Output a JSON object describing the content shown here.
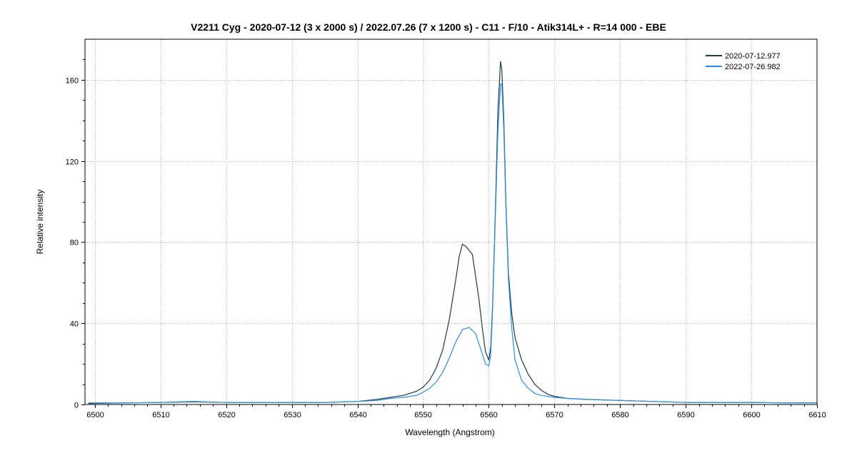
{
  "chart_data": {
    "type": "line",
    "title": "V2211 Cyg -  2020-07-12 (3 x 2000 s) / 2022.07.26 (7 x 1200 s) - C11 - F/10 - Atik314L+  - R=14 000  - EBE",
    "xlabel": "Wavelength (Angstrom)",
    "ylabel": "Relative intensity",
    "xlim": [
      6498.5,
      6610
    ],
    "ylim": [
      0,
      180
    ],
    "xticks": [
      6500,
      6510,
      6520,
      6530,
      6540,
      6550,
      6560,
      6570,
      6580,
      6590,
      6600,
      6610
    ],
    "yticks": [
      0,
      40,
      80,
      120,
      160
    ],
    "grid": true,
    "legend_position": "top-right",
    "series": [
      {
        "name": "2020-07-12.977",
        "color": "#1e3a4a",
        "x": [
          6499,
          6505,
          6510,
          6515,
          6520,
          6525,
          6530,
          6535,
          6540,
          6543,
          6545,
          6547,
          6549,
          6550,
          6551,
          6552,
          6553,
          6554,
          6555,
          6555.5,
          6556,
          6556.5,
          6557,
          6557.5,
          6558,
          6558.5,
          6559,
          6559.5,
          6560,
          6560.3,
          6560.6,
          6561,
          6561.4,
          6561.8,
          6562,
          6562.3,
          6562.6,
          6563,
          6563.5,
          6564,
          6565,
          6566,
          6567,
          6568,
          6569,
          6570,
          6572,
          6575,
          6580,
          6585,
          6590,
          6595,
          6600,
          6605,
          6610
        ],
        "values": [
          0.5,
          0.8,
          1.0,
          1.3,
          1.0,
          1.0,
          1.0,
          1.0,
          1.5,
          2.5,
          3.5,
          4.5,
          6.5,
          8.5,
          12,
          18,
          27,
          42,
          62,
          73,
          79,
          78,
          76,
          74,
          63,
          52,
          38,
          26,
          22,
          28,
          50,
          95,
          145,
          169,
          165,
          140,
          100,
          65,
          45,
          33,
          22,
          15,
          10,
          7,
          5,
          4,
          3,
          2.5,
          2,
          1.5,
          1,
          1,
          1,
          0.8,
          0.8
        ]
      },
      {
        "name": "2022-07-26.982",
        "color": "#2b8fe8",
        "x": [
          6499,
          6505,
          6510,
          6515,
          6520,
          6525,
          6530,
          6535,
          6540,
          6543,
          6545,
          6547,
          6549,
          6550,
          6551,
          6552,
          6553,
          6554,
          6555,
          6556,
          6557,
          6558,
          6558.5,
          6559,
          6559.5,
          6560,
          6560.3,
          6560.6,
          6561,
          6561.4,
          6561.8,
          6562,
          6562.3,
          6562.6,
          6563,
          6563.5,
          6564,
          6565,
          6566,
          6567,
          6568,
          6569,
          6570,
          6572,
          6575,
          6580,
          6585,
          6590,
          6595,
          6600,
          6605,
          6610
        ],
        "values": [
          0.8,
          0.8,
          1.0,
          1.5,
          1.0,
          1.0,
          1.0,
          1.0,
          1.5,
          2.0,
          3.0,
          3.5,
          4.5,
          6.0,
          8.0,
          11,
          16,
          23,
          31,
          37,
          38,
          35,
          30,
          25,
          20,
          19,
          24,
          48,
          92,
          135,
          158,
          158,
          135,
          98,
          62,
          38,
          22,
          12,
          8,
          5.5,
          4.5,
          4,
          3.5,
          3,
          2.5,
          2,
          1.5,
          1,
          1,
          1,
          0.8,
          0.8
        ]
      }
    ]
  }
}
